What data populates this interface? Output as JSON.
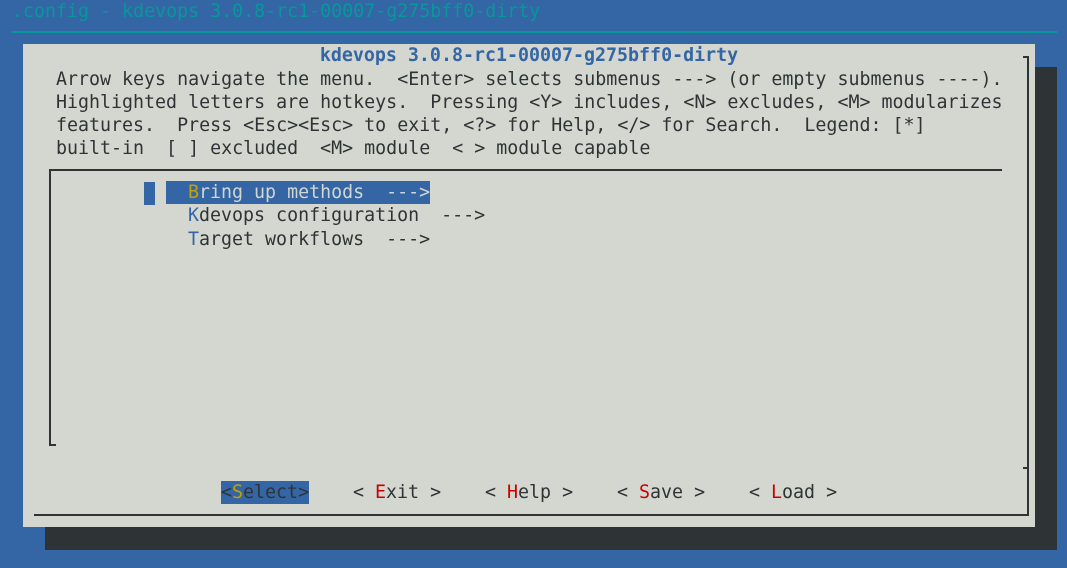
{
  "window_title": ".config - kdevops 3.0.8-rc1-00007-g275bff0-dirty",
  "dialog": {
    "title": "kdevops 3.0.8-rc1-00007-g275bff0-dirty",
    "help_lines": [
      "Arrow keys navigate the menu.  <Enter> selects submenus ---> (or empty submenus ----).",
      "Highlighted letters are hotkeys.  Pressing <Y> includes, <N> excludes, <M> modularizes",
      "features.  Press <Esc><Esc> to exit, <?> for Help, </> for Search.  Legend: [*]",
      "built-in  [ ] excluded  <M> module  < > module capable"
    ]
  },
  "menu": {
    "items": [
      {
        "hotkey": "B",
        "rest": "ring up methods  --->",
        "selected": true
      },
      {
        "hotkey": "K",
        "rest": "devops configuration  --->",
        "selected": false
      },
      {
        "hotkey": "T",
        "rest": "arget workflows  --->",
        "selected": false
      }
    ]
  },
  "buttons": [
    {
      "pre": "<",
      "hotkey": "S",
      "rest": "elect",
      "post": ">",
      "selected": true
    },
    {
      "pre": "< ",
      "hotkey": "E",
      "rest": "xit",
      "post": " >",
      "selected": false
    },
    {
      "pre": "< ",
      "hotkey": "H",
      "rest": "elp",
      "post": " >",
      "selected": false
    },
    {
      "pre": "< ",
      "hotkey": "S",
      "rest": "ave",
      "post": " >",
      "selected": false
    },
    {
      "pre": "< ",
      "hotkey": "L",
      "rest": "oad",
      "post": " >",
      "selected": false
    }
  ],
  "colors": {
    "background": "#3465a4",
    "title": "#06989a",
    "dialog": "#d3d7cf",
    "hotkey_button": "#cc0000",
    "hotkey_selected": "#c4a000"
  }
}
